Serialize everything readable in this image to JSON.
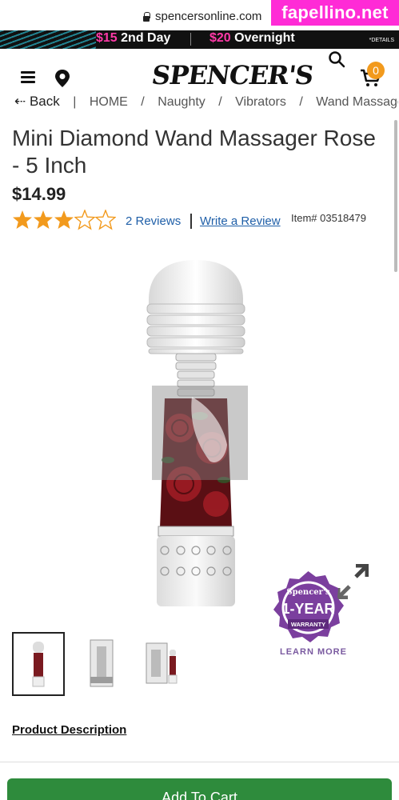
{
  "browser": {
    "url": "spencersonline.com"
  },
  "watermark": "fapellino.net",
  "promo": {
    "offer1_price": "$15",
    "offer1_label": "2nd Day",
    "offer2_price": "$20",
    "offer2_label": "Overnight",
    "details": "*DETAILS"
  },
  "header": {
    "logo": "SPENCER'S",
    "cart_count": "0"
  },
  "breadcrumb": {
    "back": "Back",
    "items": [
      "HOME",
      "Naughty",
      "Vibrators",
      "Wand Massagers"
    ]
  },
  "product": {
    "title": "Mini Diamond Wand Massager Rose - 5 Inch",
    "price": "$14.99",
    "rating": {
      "value": 3,
      "max": 5
    },
    "reviews_label": "2 Reviews",
    "write_review_label": "Write a Review",
    "item_label": "Item#",
    "item_number": "03518479"
  },
  "warranty": {
    "brand": "Spencer's",
    "line1": "1-YEAR",
    "line2": "WARRANTY",
    "learn_more": "LEARN MORE"
  },
  "description_link": "Product Description",
  "add_to_cart": "Add To Cart",
  "colors": {
    "accent_orange": "#f29a1d",
    "link_blue": "#1f5fa8",
    "promo_pink": "#ff3aa8",
    "cart_green": "#2e8b3c",
    "warranty_purple": "#7b3f9e"
  }
}
